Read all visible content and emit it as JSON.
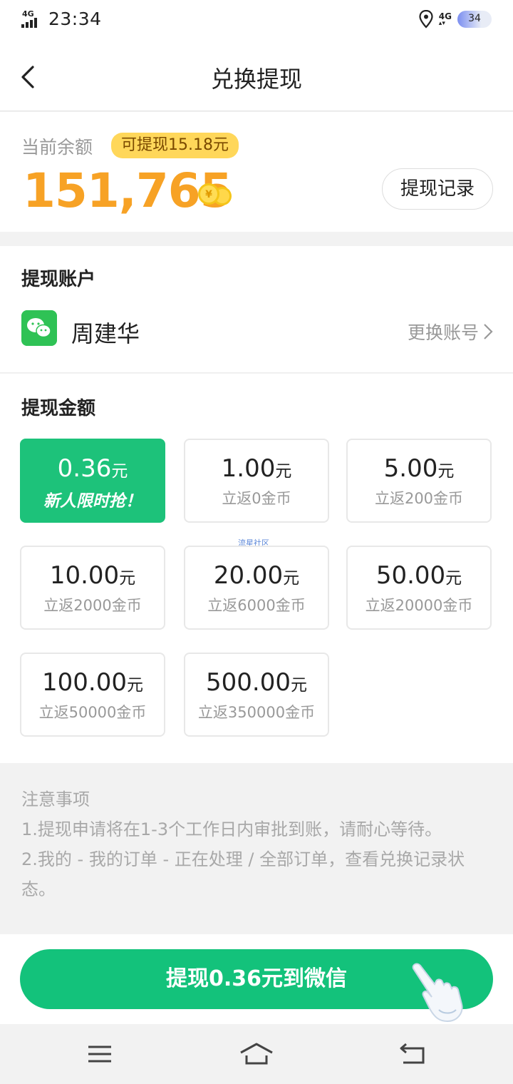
{
  "status_bar": {
    "network_left": "4G",
    "time": "23:34",
    "network_right": "4G",
    "battery": "34"
  },
  "nav": {
    "title": "兑换提现"
  },
  "balance": {
    "label": "当前余额",
    "withdrawable_tag": "可提现15.18元",
    "amount": "151,765",
    "record_button": "提现记录"
  },
  "account": {
    "title": "提现账户",
    "name": "周建华",
    "change_label": "更换账号"
  },
  "amount_section": {
    "title": "提现金额",
    "options": [
      {
        "value": "0.36",
        "unit": "元",
        "sub": "新人限时抢！",
        "selected": true
      },
      {
        "value": "1.00",
        "unit": "元",
        "sub": "立返0金币"
      },
      {
        "value": "5.00",
        "unit": "元",
        "sub": "立返200金币"
      },
      {
        "value": "10.00",
        "unit": "元",
        "sub": "立返2000金币"
      },
      {
        "value": "20.00",
        "unit": "元",
        "sub": "立返6000金币"
      },
      {
        "value": "50.00",
        "unit": "元",
        "sub": "立返20000金币"
      },
      {
        "value": "100.00",
        "unit": "元",
        "sub": "立返50000金币"
      },
      {
        "value": "500.00",
        "unit": "元",
        "sub": "立返350000金币"
      }
    ],
    "watermark": "流星社区"
  },
  "notes": {
    "title": "注意事项",
    "line1": "1.提现申请将在1-3个工作日内审批到账，请耐心等待。",
    "line2": "2.我的 - 我的订单 - 正在处理 / 全部订单，查看兑换记录状态。"
  },
  "withdraw_button": "提现0.36元到微信",
  "colors": {
    "accent_green": "#13c27b",
    "balance_orange": "#f7a225",
    "tag_yellow": "#ffd75a"
  },
  "icons": [
    "signal-icon",
    "location-icon",
    "battery-icon",
    "back-icon",
    "coin-icon",
    "wechat-icon",
    "chevron-right-icon",
    "hand-pointer-icon",
    "menu-icon",
    "home-icon",
    "back-nav-icon"
  ]
}
